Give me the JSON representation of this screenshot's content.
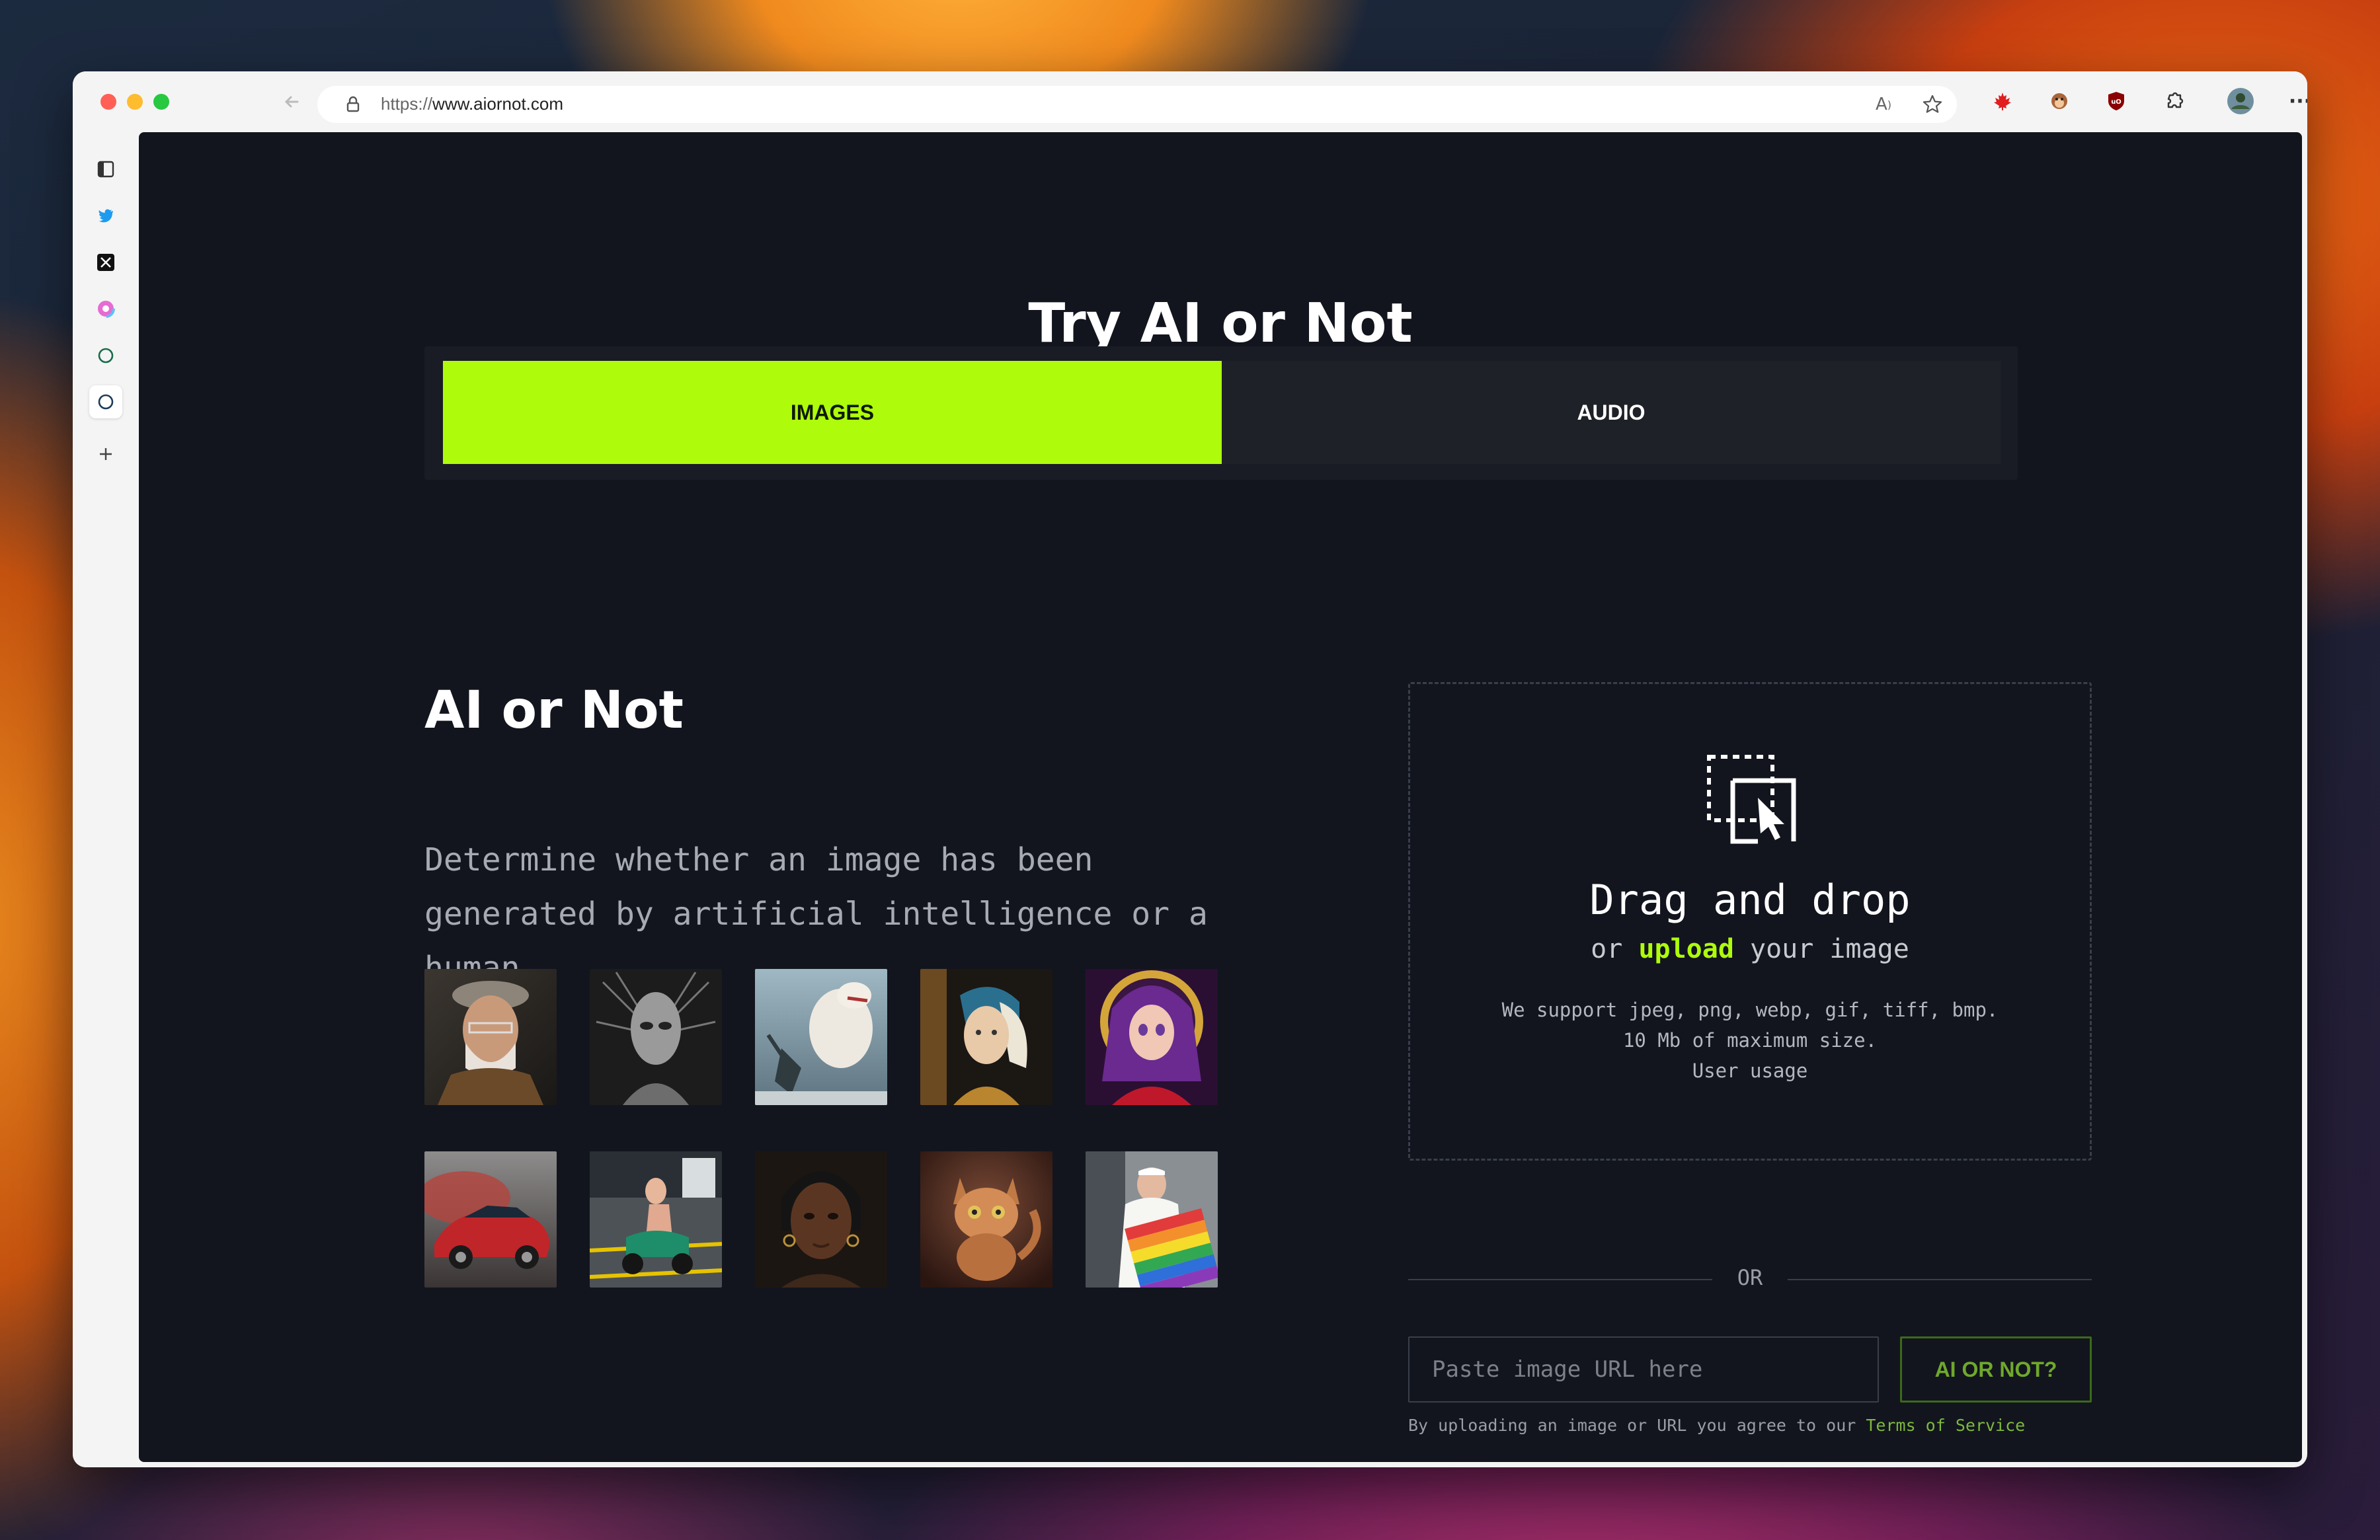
{
  "browser": {
    "url_scheme": "https://",
    "url_host": "www.aiornot.com",
    "sidebar_icons": [
      "tab-overview-icon",
      "twitter-icon",
      "x-icon",
      "color-app-icon",
      "circle-icon",
      "circle-icon-active",
      "add-icon"
    ],
    "toolbar_icons": [
      "read-aloud-icon",
      "favorite-star-icon",
      "canada-flag-icon",
      "monkey-extension-icon",
      "ublock-icon",
      "extensions-puzzle-icon",
      "profile-avatar-icon",
      "more-icon"
    ]
  },
  "page": {
    "title": "Try AI or Not",
    "tabs": [
      {
        "label": "IMAGES",
        "active": true
      },
      {
        "label": "AUDIO",
        "active": false
      }
    ],
    "heading": "AI or Not",
    "description": "Determine whether an image has been generated by artificial intelligence or a human",
    "sample_images": [
      "old-man-portrait",
      "alien-sculpture",
      "polar-bear-fight",
      "pearl-earring-girl",
      "anime-girl",
      "red-sports-car",
      "scooter-rider",
      "woman-portrait",
      "robot-kitten",
      "pope-rainbow-coat"
    ]
  },
  "upload": {
    "title": "Drag and drop",
    "sub_prefix": "or",
    "sub_link": "upload",
    "sub_suffix": "your image",
    "formats": "We support jpeg, png, webp, gif, tiff, bmp.",
    "max_size": "10 Mb of maximum size.",
    "usage": "User usage",
    "or_label": "OR",
    "url_placeholder": "Paste image URL here",
    "submit_label": "AI OR NOT?",
    "terms_prefix": "By uploading an image or URL you agree to our",
    "terms_link": "Terms of Service"
  },
  "colors": {
    "accent": "#aefc0c",
    "background": "#12151e",
    "tab_inactive": "#1f2128"
  }
}
